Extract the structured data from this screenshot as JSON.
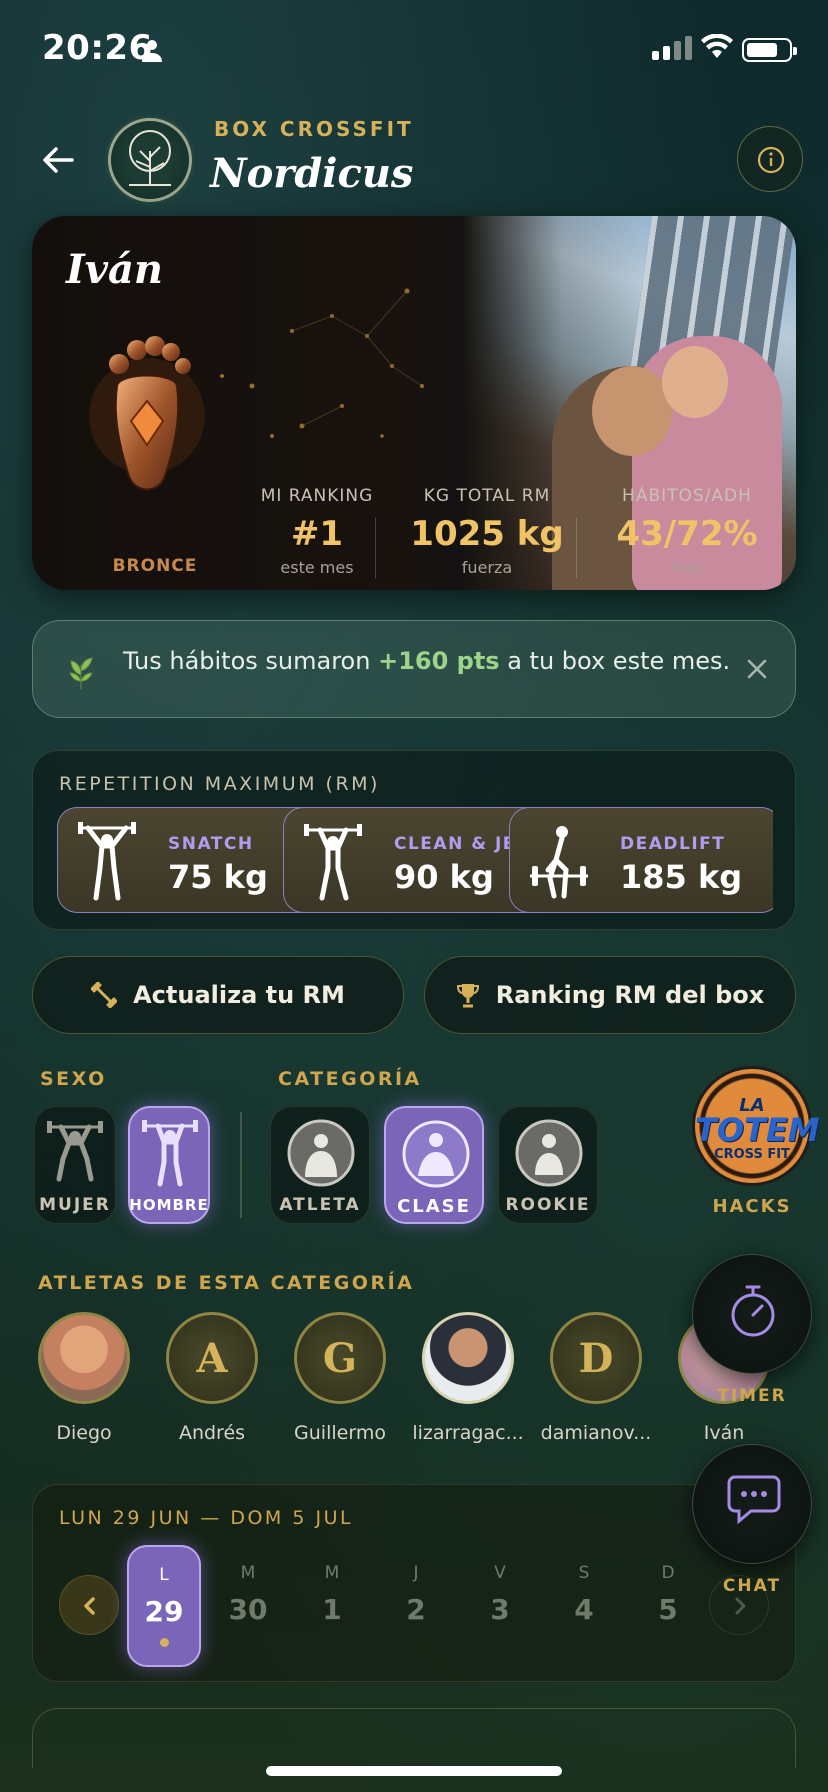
{
  "status_bar": {
    "time": "20:26"
  },
  "header": {
    "brand_top": "BOX CROSSFIT",
    "brand_name": "Nordicus"
  },
  "hero": {
    "name": "Iván",
    "rank_tier": "BRONCE",
    "stats": [
      {
        "label": "MI RANKING",
        "value": "#1",
        "sub": "este mes"
      },
      {
        "label": "KG TOTAL RM",
        "value": "1025 kg",
        "sub": "fuerza"
      },
      {
        "label": "HÁBITOS/ADH",
        "value": "43/72%",
        "sub": "mes"
      }
    ]
  },
  "notice": {
    "prefix": "Tus hábitos sumaron ",
    "highlight": "+160 pts",
    "suffix": " a tu box este mes."
  },
  "rm": {
    "title": "REPETITION MAXIMUM (RM)",
    "lifts": [
      {
        "name": "SNATCH",
        "value": "75 kg"
      },
      {
        "name": "CLEAN & JERK",
        "value": "90 kg"
      },
      {
        "name": "DEADLIFT",
        "value": "185 kg"
      }
    ]
  },
  "actions": {
    "update_rm": "Actualiza tu RM",
    "ranking_rm": "Ranking RM del box"
  },
  "filters": {
    "sexo_label": "SEXO",
    "sexo": [
      {
        "label": "MUJER",
        "selected": false
      },
      {
        "label": "HOMBRE",
        "selected": true
      }
    ],
    "categoria_label": "CATEGORÍA",
    "categoria": [
      {
        "label": "ATLETA",
        "selected": false
      },
      {
        "label": "CLASE",
        "selected": true
      },
      {
        "label": "ROOKIE",
        "selected": false
      }
    ]
  },
  "hacks": {
    "logo_line1": "LA",
    "logo_line2": "TOTEM",
    "logo_line3": "CROSS FIT",
    "label": "HACKS"
  },
  "athletes": {
    "title": "ATLETAS DE ESTA CATEGORÍA",
    "items": [
      {
        "name": "Diego",
        "initial": ""
      },
      {
        "name": "Andrés",
        "initial": "A"
      },
      {
        "name": "Guillermo",
        "initial": "G"
      },
      {
        "name": "lizarragac...",
        "initial": ""
      },
      {
        "name": "damianov...",
        "initial": "D"
      },
      {
        "name": "Iván",
        "initial": ""
      }
    ]
  },
  "fabs": {
    "timer": "TIMER",
    "chat": "CHAT"
  },
  "week": {
    "title": "LUN 29 JUN — DOM 5 JUL",
    "days": [
      {
        "letter": "L",
        "num": "29",
        "selected": true
      },
      {
        "letter": "M",
        "num": "30"
      },
      {
        "letter": "M",
        "num": "1"
      },
      {
        "letter": "J",
        "num": "2"
      },
      {
        "letter": "V",
        "num": "3"
      },
      {
        "letter": "S",
        "num": "4"
      },
      {
        "letter": "D",
        "num": "5"
      }
    ]
  },
  "colors": {
    "accent_gold": "#d6b15a",
    "accent_purple": "#7a65b8",
    "positive_green": "#9ed38a"
  }
}
